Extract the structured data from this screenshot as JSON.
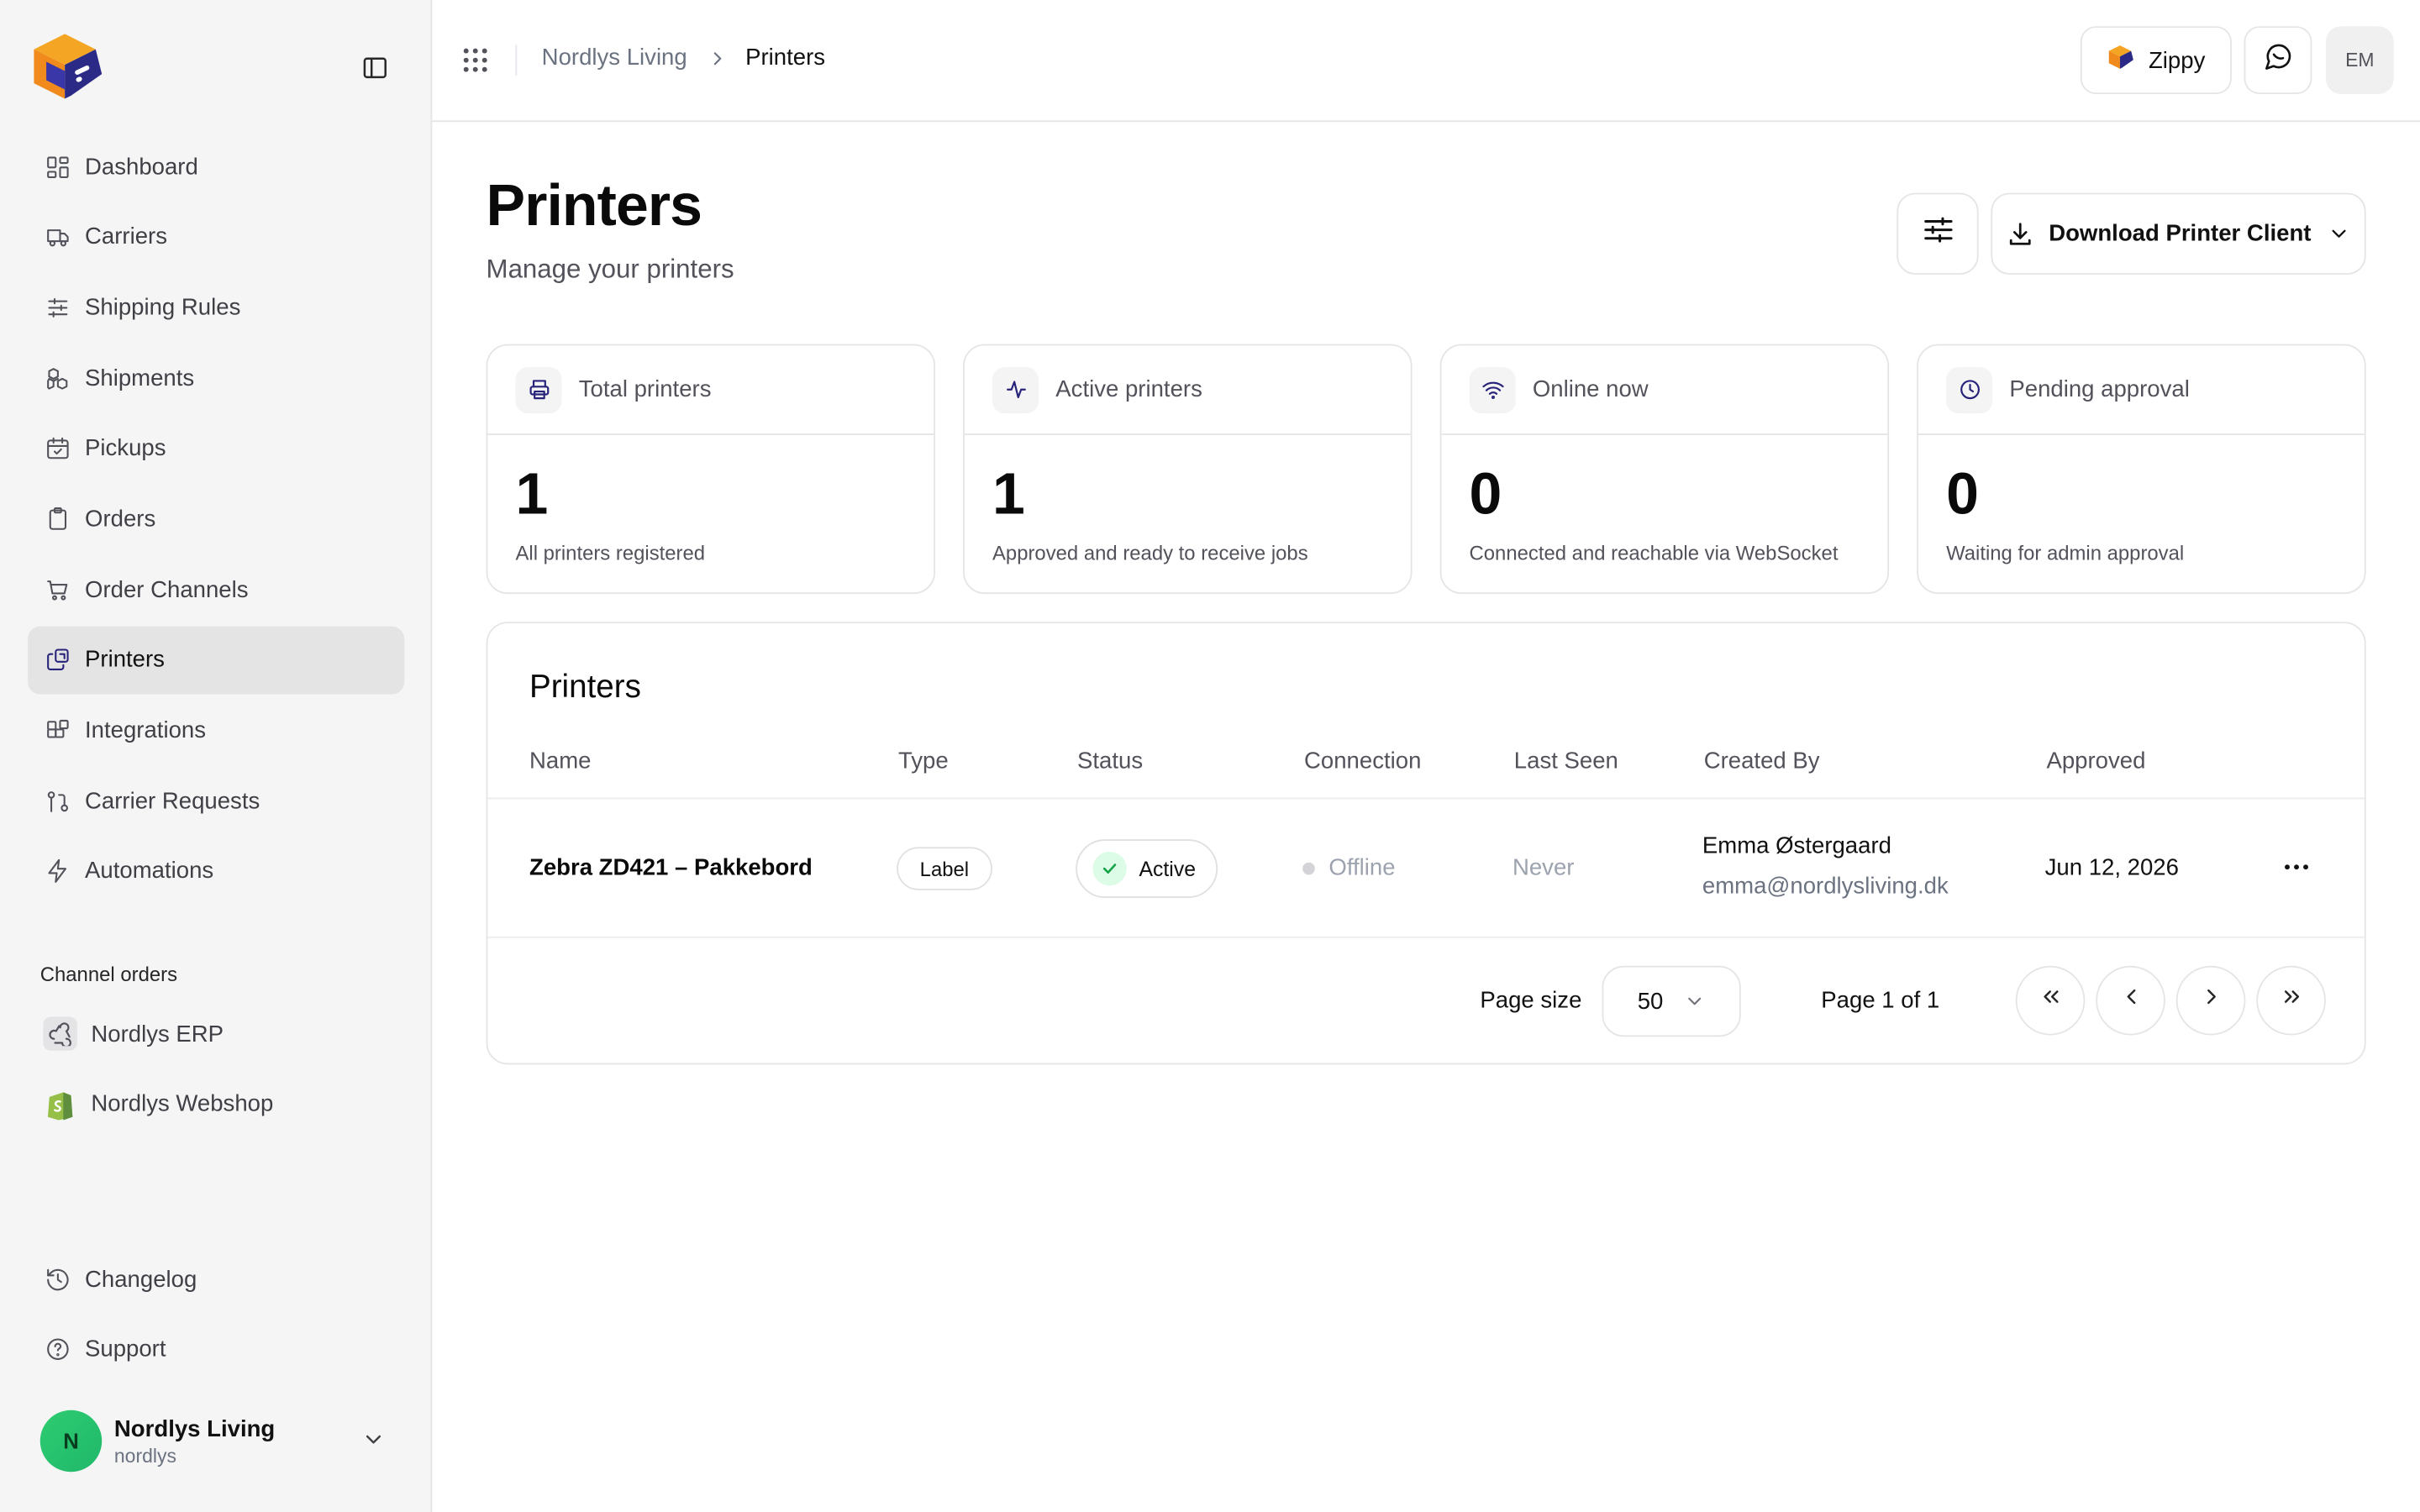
{
  "sidebar": {
    "items": [
      {
        "label": "Dashboard",
        "icon": "dashboard-icon"
      },
      {
        "label": "Carriers",
        "icon": "truck-icon"
      },
      {
        "label": "Shipping Rules",
        "icon": "sliders-icon"
      },
      {
        "label": "Shipments",
        "icon": "boxes-icon"
      },
      {
        "label": "Pickups",
        "icon": "calendar-check-icon"
      },
      {
        "label": "Orders",
        "icon": "clipboard-icon"
      },
      {
        "label": "Order Channels",
        "icon": "cart-icon"
      },
      {
        "label": "Printers",
        "icon": "printer-stack-icon",
        "active": true
      },
      {
        "label": "Integrations",
        "icon": "blocks-icon"
      },
      {
        "label": "Carrier Requests",
        "icon": "git-pull-icon"
      },
      {
        "label": "Automations",
        "icon": "bolt-icon"
      }
    ],
    "section_label": "Channel orders",
    "channels": [
      {
        "label": "Nordlys ERP",
        "icon": "webhook-icon"
      },
      {
        "label": "Nordlys Webshop",
        "icon": "shopify-icon"
      }
    ],
    "bottom_items": [
      {
        "label": "Changelog",
        "icon": "history-icon"
      },
      {
        "label": "Support",
        "icon": "help-circle-icon"
      }
    ],
    "account": {
      "initial": "N",
      "name": "Nordlys Living",
      "handle": "nordlys"
    }
  },
  "topbar": {
    "breadcrumb": [
      "Nordlys Living",
      "Printers"
    ],
    "zippy_label": "Zippy",
    "user_initials": "EM"
  },
  "page": {
    "title": "Printers",
    "subtitle": "Manage your printers",
    "download_label": "Download Printer Client"
  },
  "stats": [
    {
      "label": "Total printers",
      "value": "1",
      "desc": "All printers registered",
      "icon": "printer-icon"
    },
    {
      "label": "Active printers",
      "value": "1",
      "desc": "Approved and ready to receive jobs",
      "icon": "activity-icon"
    },
    {
      "label": "Online now",
      "value": "0",
      "desc": "Connected and reachable via WebSocket",
      "icon": "wifi-icon"
    },
    {
      "label": "Pending approval",
      "value": "0",
      "desc": "Waiting for admin approval",
      "icon": "clock-icon"
    }
  ],
  "table": {
    "title": "Printers",
    "columns": [
      "Name",
      "Type",
      "Status",
      "Connection",
      "Last Seen",
      "Created By",
      "Approved"
    ],
    "rows": [
      {
        "name": "Zebra ZD421 – Pakkebord",
        "type": "Label",
        "status": "Active",
        "connection": "Offline",
        "last_seen": "Never",
        "created_by_name": "Emma Østergaard",
        "created_by_email": "emma@nordlysliving.dk",
        "approved": "Jun 12, 2026"
      }
    ],
    "pagination": {
      "page_size_label": "Page size",
      "page_size": "50",
      "page_info": "Page 1 of 1"
    }
  },
  "colors": {
    "accent": "#27237a",
    "brand_orange": "#f5a524",
    "active_green": "#dcfce7",
    "avatar_green": "#22c55e"
  }
}
